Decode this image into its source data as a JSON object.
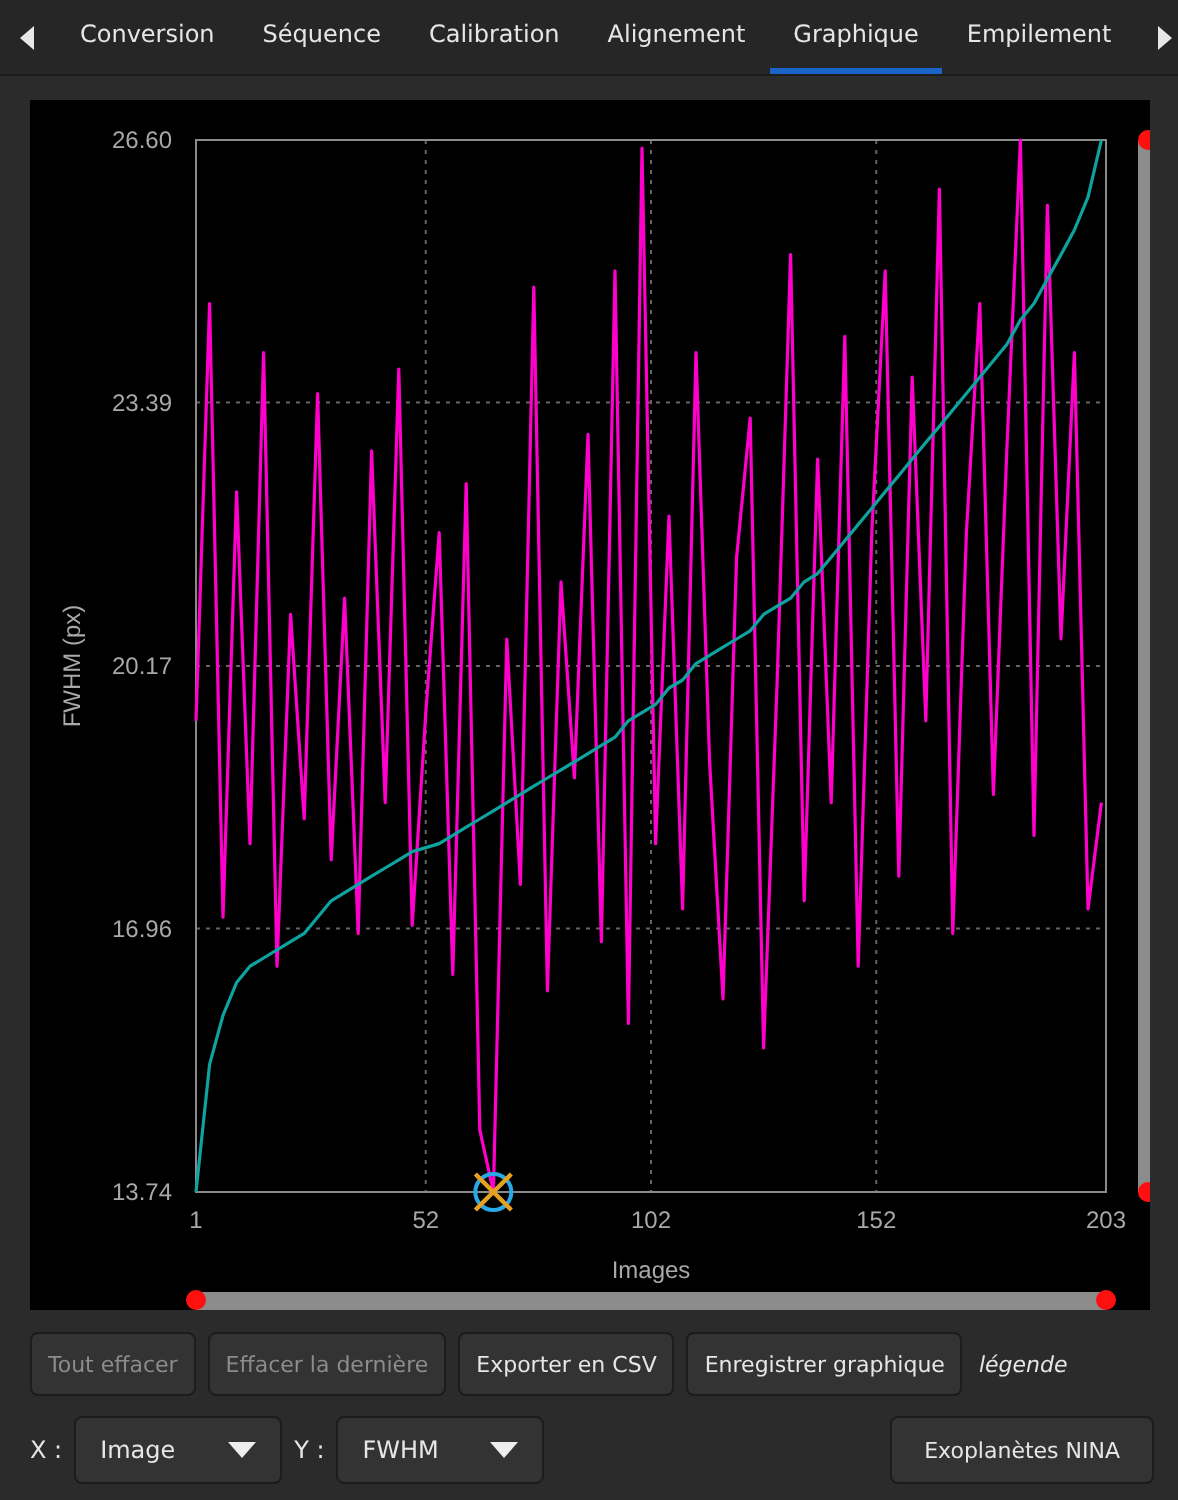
{
  "tabs": [
    {
      "label": "Conversion",
      "selected": false
    },
    {
      "label": "Séquence",
      "selected": false
    },
    {
      "label": "Calibration",
      "selected": false
    },
    {
      "label": "Alignement",
      "selected": false
    },
    {
      "label": "Graphique",
      "selected": true
    },
    {
      "label": "Empilement",
      "selected": false
    }
  ],
  "plot": {
    "chart_data": {
      "type": "line",
      "xlabel": "Images",
      "ylabel": "FWHM (px)",
      "x": [
        1,
        4,
        7,
        10,
        13,
        16,
        19,
        22,
        25,
        28,
        31,
        34,
        37,
        40,
        43,
        46,
        49,
        52,
        55,
        58,
        61,
        64,
        67,
        70,
        73,
        76,
        79,
        82,
        85,
        88,
        91,
        94,
        97,
        100,
        103,
        106,
        109,
        112,
        115,
        118,
        121,
        124,
        127,
        130,
        133,
        136,
        139,
        142,
        145,
        148,
        151,
        154,
        157,
        160,
        163,
        166,
        169,
        172,
        175,
        178,
        181,
        184,
        187,
        190,
        193,
        196,
        199,
        202
      ],
      "grid": true,
      "series": [
        {
          "color": "#ff00cc",
          "values": [
            19.5,
            24.6,
            17.1,
            22.3,
            18.0,
            24.0,
            16.5,
            20.8,
            18.3,
            23.5,
            17.8,
            21.0,
            16.9,
            22.8,
            18.5,
            23.8,
            17.0,
            19.6,
            21.8,
            16.4,
            22.4,
            14.5,
            13.74,
            20.5,
            17.5,
            24.8,
            16.2,
            21.2,
            18.8,
            23.0,
            16.8,
            25.0,
            15.8,
            26.5,
            18.0,
            22.0,
            17.2,
            24.0,
            19.0,
            16.1,
            21.5,
            23.2,
            15.5,
            20.0,
            25.2,
            17.3,
            22.7,
            18.5,
            24.2,
            16.5,
            21.8,
            25.0,
            17.6,
            23.7,
            19.5,
            26.0,
            16.9,
            21.8,
            24.6,
            18.6,
            22.8,
            26.6,
            18.1,
            25.8,
            20.5,
            24.0,
            17.2,
            18.5
          ]
        },
        {
          "color": "#0fa3a0",
          "values": [
            13.74,
            15.3,
            15.9,
            16.3,
            16.5,
            16.6,
            16.7,
            16.8,
            16.9,
            17.1,
            17.3,
            17.4,
            17.5,
            17.6,
            17.7,
            17.8,
            17.9,
            17.95,
            18.0,
            18.1,
            18.2,
            18.3,
            18.4,
            18.5,
            18.6,
            18.7,
            18.8,
            18.9,
            19.0,
            19.1,
            19.2,
            19.3,
            19.5,
            19.6,
            19.7,
            19.9,
            20.0,
            20.2,
            20.3,
            20.4,
            20.5,
            20.6,
            20.8,
            20.9,
            21.0,
            21.2,
            21.3,
            21.5,
            21.7,
            21.9,
            22.1,
            22.3,
            22.5,
            22.7,
            22.9,
            23.1,
            23.3,
            23.5,
            23.7,
            23.9,
            24.1,
            24.4,
            24.6,
            24.9,
            25.2,
            25.5,
            25.9,
            26.6
          ]
        }
      ],
      "xlim": [
        1,
        203
      ],
      "ylim": [
        13.74,
        26.6
      ],
      "xticks": [
        1,
        52,
        102,
        152,
        203
      ],
      "yticks": [
        13.74,
        16.96,
        20.17,
        23.39,
        {
          "value": 26.6,
          "label": "26.60"
        }
      ]
    }
  },
  "buttons": [
    {
      "label": "Tout effacer",
      "disabled": true
    },
    {
      "label": "Effacer la dernière",
      "disabled": true
    },
    {
      "label": "Exporter en CSV",
      "disabled": false
    },
    {
      "label": "Enregistrer graphique",
      "disabled": false
    }
  ],
  "legend_label": "légende",
  "x_axis": {
    "label": "X :",
    "value": "Image"
  },
  "y_axis": {
    "label": "Y :",
    "value": "FWHM"
  },
  "nina_button": "Exoplanètes NINA"
}
